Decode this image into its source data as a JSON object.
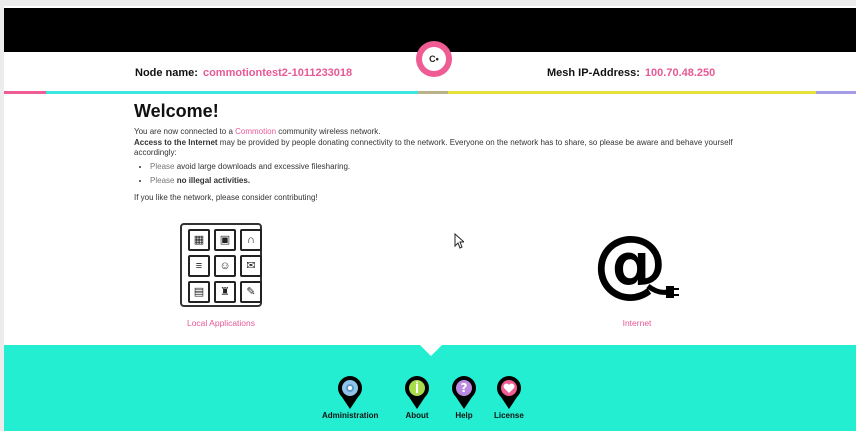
{
  "header": {
    "node_label": "Node name:",
    "node_value": "commotiontest2-1011233018",
    "mesh_label": "Mesh IP-Address:",
    "mesh_value": "100.70.48.250",
    "logo_text": "C•"
  },
  "welcome": {
    "title": "Welcome!",
    "connected_pre": "You are now connected to a ",
    "connected_link": "Commotion",
    "connected_post": " community wireless network.",
    "access_bold": "Access to the Internet",
    "access_rest": " may be provided by people donating connectivity to the network. Everyone on the network has to share, so please be aware and behave yourself accordingly:",
    "bullet1_pre": "Please",
    "bullet1_rest": " avoid large downloads and excessive filesharing.",
    "bullet2_pre": "Please",
    "bullet2_rest": " no illegal activities.",
    "contribute": "If you like the network, please consider contributing!"
  },
  "links": {
    "local_apps": "Local Applications",
    "internet": "Internet"
  },
  "footer_nav": [
    {
      "label": "Administration",
      "icon": "gear-icon",
      "color": "#8fc4e8"
    },
    {
      "label": "About",
      "icon": "info-icon",
      "color": "#a8dc4a"
    },
    {
      "label": "Help",
      "icon": "question-icon",
      "color": "#b98ae0"
    },
    {
      "label": "License",
      "icon": "heart-icon",
      "color": "#ee5c93"
    }
  ],
  "colors": {
    "accent_pink": "#e75896",
    "footer_teal": "#23eed1",
    "stripe_cyan": "#3ee6e0",
    "stripe_yellow": "#e8e03a",
    "stripe_purple": "#a59ce8"
  }
}
